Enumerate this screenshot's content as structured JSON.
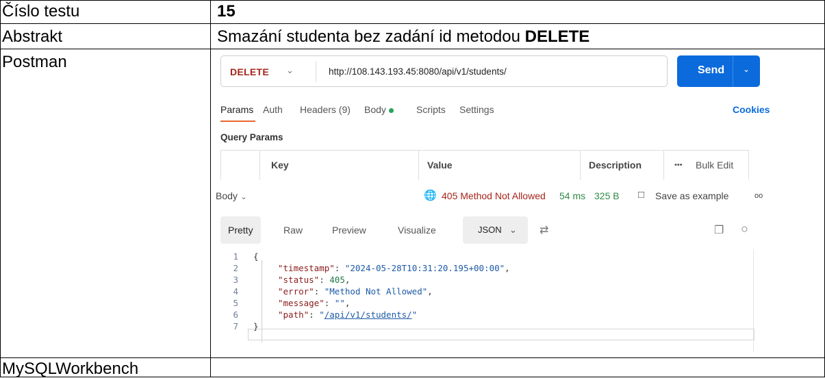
{
  "table": {
    "rows": [
      {
        "label": "Číslo testu",
        "value": "15"
      },
      {
        "label": "Abstrakt",
        "value_prefix": "Smazání studenta bez zadání id metodou ",
        "value_bold": "DELETE"
      },
      {
        "label": "Postman"
      },
      {
        "label": "MySQLWorkbench",
        "value": ""
      }
    ]
  },
  "postman": {
    "method": "DELETE",
    "url": "http://108.143.193.45:8080/api/v1/students/",
    "send_label": "Send",
    "tabs": [
      "Params",
      "Auth",
      "Headers (9)",
      "Body",
      "Scripts",
      "Settings"
    ],
    "cookies_label": "Cookies",
    "query_params_title": "Query Params",
    "query_columns": [
      "Key",
      "Value",
      "Description"
    ],
    "bulk_edit_label": "Bulk Edit",
    "more_label": "•••",
    "response": {
      "body_label": "Body",
      "status": "405 Method Not Allowed",
      "time": "54 ms",
      "size": "325 B",
      "save_label": "Save as example",
      "more": "oo"
    },
    "view_tabs": [
      "Pretty",
      "Raw",
      "Preview",
      "Visualize"
    ],
    "format": "JSON",
    "code_lines": [
      {
        "n": "1",
        "t": "{"
      },
      {
        "n": "2",
        "key": "\"timestamp\"",
        "val": "\"2024-05-28T10:31:20.195+00:00\"",
        "type": "s",
        "comma": ","
      },
      {
        "n": "3",
        "key": "\"status\"",
        "val": "405",
        "type": "n",
        "comma": ","
      },
      {
        "n": "4",
        "key": "\"error\"",
        "val": "\"Method Not Allowed\"",
        "type": "s",
        "comma": ","
      },
      {
        "n": "5",
        "key": "\"message\"",
        "val": "\"\"",
        "type": "s",
        "comma": ","
      },
      {
        "n": "6",
        "key": "\"path\"",
        "val_open": "\"",
        "val_link": "/api/v1/students/",
        "val_close": "\"",
        "type": "u",
        "comma": ""
      },
      {
        "n": "7",
        "t": "}"
      }
    ]
  },
  "colors": {
    "method": "#a6241a",
    "send": "#0b6bdc",
    "status_ok_text": "#2e8a45",
    "active_tab_underline": "#e8642c"
  },
  "icons": {
    "status_globe": "globe-icon",
    "save": "save-icon",
    "copy": "copy-icon",
    "search": "search-icon",
    "wrap": "wrap-lines-icon"
  }
}
